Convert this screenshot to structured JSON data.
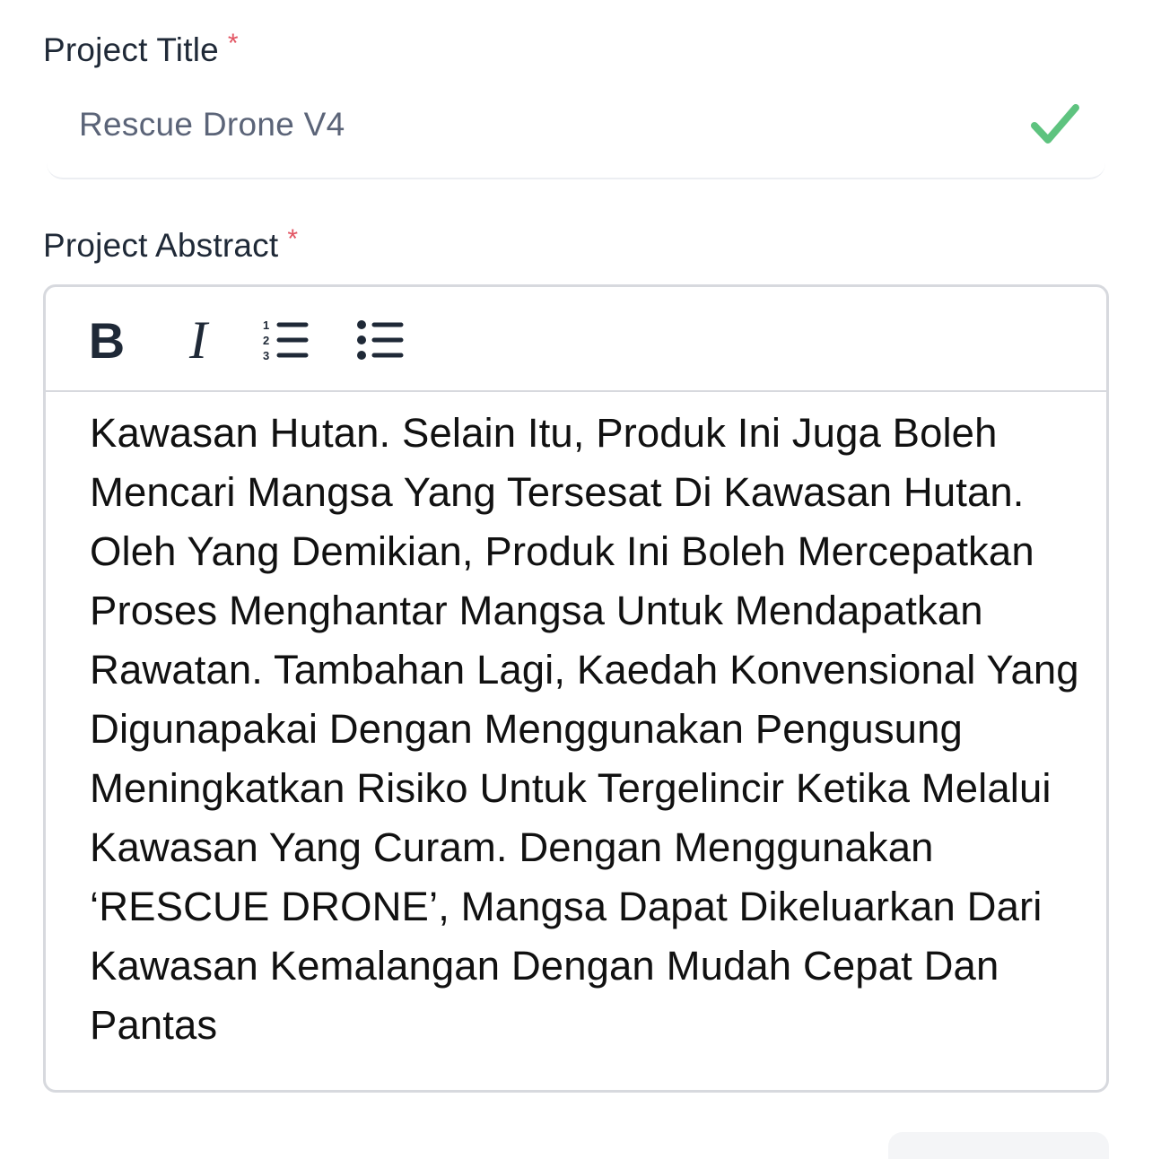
{
  "fields": {
    "title": {
      "label": "Project Title",
      "required_mark": "*",
      "value": "Rescue Drone V4",
      "status_icon": "check-icon",
      "status_color": "#5ec37f"
    },
    "abstract": {
      "label": "Project Abstract",
      "required_mark": "*",
      "toolbar": {
        "bold": "B",
        "italic": "I",
        "ordered_list_icon": "ordered-list-icon",
        "bullet_list_icon": "bullet-list-icon"
      },
      "value": "Kawasan Hutan. Selain Itu, Produk Ini Juga Boleh Mencari Mangsa Yang Tersesat Di Kawasan Hutan. Oleh Yang Demikian, Produk Ini Boleh Mercepatkan Proses Menghantar Mangsa Untuk Mendapatkan Rawatan. Tambahan Lagi, Kaedah Konvensional Yang Digunapakai Dengan Menggunakan Pengusung Meningkatkan Risiko Untuk Tergelincir Ketika Melalui Kawasan Yang Curam. Dengan Menggunakan ‘RESCUE DRONE’, Mangsa Dapat Dikeluarkan Dari Kawasan Kemalangan Dengan Mudah Cepat Dan Pantas"
    }
  },
  "colors": {
    "required": "#e25563",
    "border": "#d7d9de",
    "text": "#111111"
  }
}
